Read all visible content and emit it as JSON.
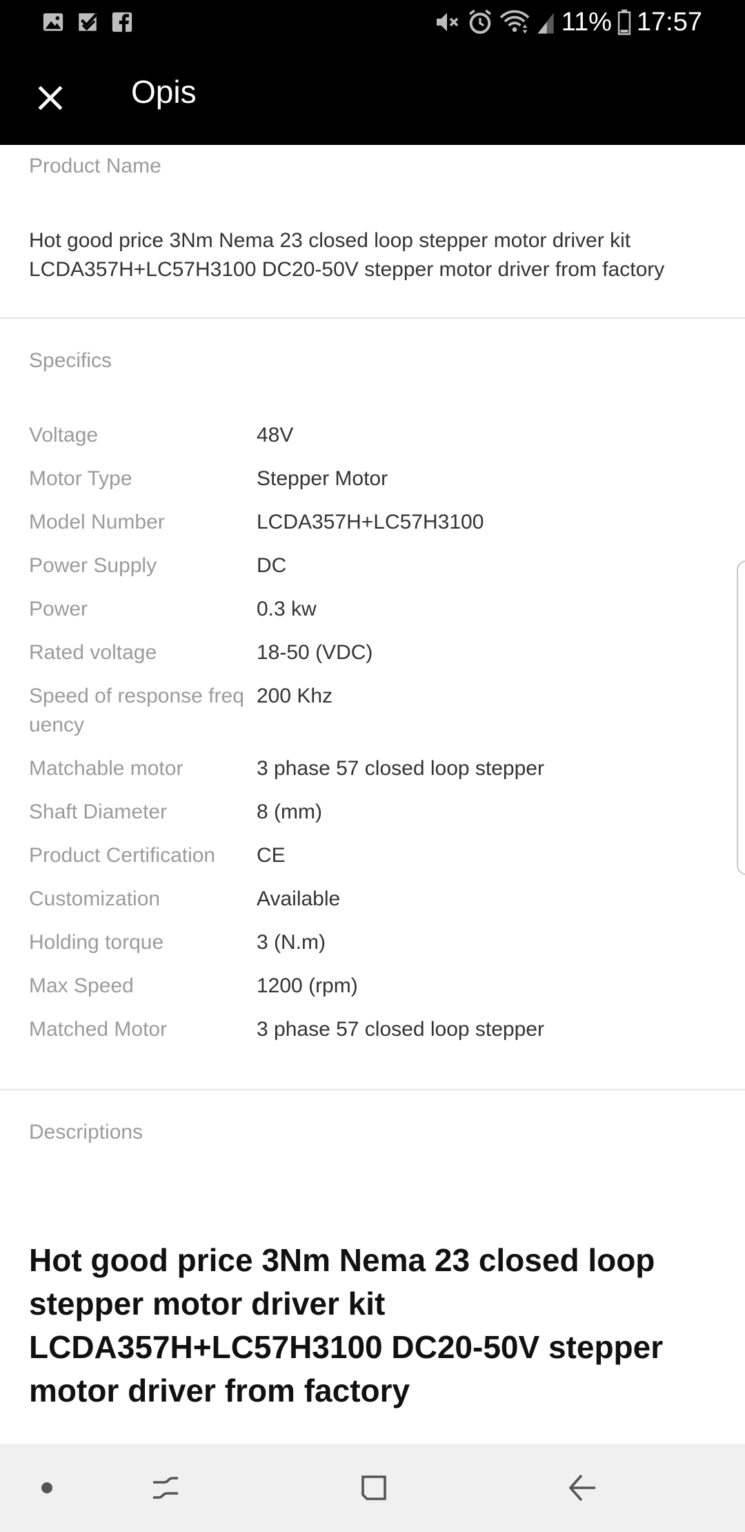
{
  "status_bar": {
    "battery": "11%",
    "time": "17:57",
    "left_icons": [
      "gallery-icon",
      "inbox-check-icon",
      "facebook-icon"
    ],
    "right_icons": [
      "mute-icon",
      "alarm-icon",
      "wifi-icon",
      "signal-icon",
      "battery-icon"
    ]
  },
  "app_bar": {
    "close_icon": "close-icon",
    "title": "Opis"
  },
  "product": {
    "label": "Product Name",
    "name": "Hot good price 3Nm Nema 23 closed loop stepper motor driver kit LCDA357H+LC57H3100 DC20-50V stepper motor driver from factory"
  },
  "specifics": {
    "label": "Specifics",
    "rows": [
      {
        "key": "Voltage",
        "value": "48V"
      },
      {
        "key": "Motor Type",
        "value": "Stepper Motor"
      },
      {
        "key": "Model Number",
        "value": "LCDA357H+LC57H3100"
      },
      {
        "key": "Power Supply",
        "value": "DC"
      },
      {
        "key": "Power",
        "value": "0.3 kw"
      },
      {
        "key": "Rated voltage",
        "value": "18-50 (VDC)"
      },
      {
        "key": "Speed of response freq uency",
        "value": "200 Khz"
      },
      {
        "key": "Matchable motor",
        "value": "3 phase 57 closed loop stepper"
      },
      {
        "key": "Shaft Diameter",
        "value": "8 (mm)"
      },
      {
        "key": "Product Certification",
        "value": "CE"
      },
      {
        "key": "Customization",
        "value": "Available"
      },
      {
        "key": "Holding torque",
        "value": "3 (N.m)"
      },
      {
        "key": "Max Speed",
        "value": "1200 (rpm)"
      },
      {
        "key": "Matched Motor",
        "value": "3 phase 57 closed loop stepper"
      }
    ]
  },
  "descriptions": {
    "label": "Descriptions",
    "heading": "Hot good price 3Nm Nema 23 closed loop stepper motor driver kit LCDA357H+LC57H3100 DC20-50V stepper motor driver from factory"
  },
  "nav_bar": {
    "items": [
      "dot-icon",
      "recents-icon",
      "home-icon",
      "back-icon"
    ]
  },
  "colors": {
    "bar_background": "#000000",
    "label_gray": "#9b9b9b",
    "value_text": "#333333",
    "divider": "#e6e6e6",
    "nav_background": "#f0f0f0"
  }
}
